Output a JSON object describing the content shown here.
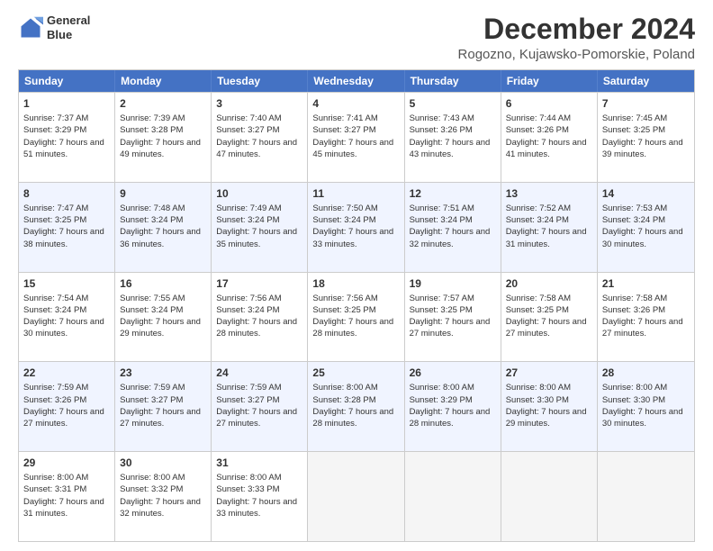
{
  "logo": {
    "line1": "General",
    "line2": "Blue"
  },
  "title": "December 2024",
  "subtitle": "Rogozno, Kujawsko-Pomorskie, Poland",
  "headers": [
    "Sunday",
    "Monday",
    "Tuesday",
    "Wednesday",
    "Thursday",
    "Friday",
    "Saturday"
  ],
  "weeks": [
    [
      {
        "day": "1",
        "rise": "Sunrise: 7:37 AM",
        "set": "Sunset: 3:29 PM",
        "daylight": "Daylight: 7 hours and 51 minutes."
      },
      {
        "day": "2",
        "rise": "Sunrise: 7:39 AM",
        "set": "Sunset: 3:28 PM",
        "daylight": "Daylight: 7 hours and 49 minutes."
      },
      {
        "day": "3",
        "rise": "Sunrise: 7:40 AM",
        "set": "Sunset: 3:27 PM",
        "daylight": "Daylight: 7 hours and 47 minutes."
      },
      {
        "day": "4",
        "rise": "Sunrise: 7:41 AM",
        "set": "Sunset: 3:27 PM",
        "daylight": "Daylight: 7 hours and 45 minutes."
      },
      {
        "day": "5",
        "rise": "Sunrise: 7:43 AM",
        "set": "Sunset: 3:26 PM",
        "daylight": "Daylight: 7 hours and 43 minutes."
      },
      {
        "day": "6",
        "rise": "Sunrise: 7:44 AM",
        "set": "Sunset: 3:26 PM",
        "daylight": "Daylight: 7 hours and 41 minutes."
      },
      {
        "day": "7",
        "rise": "Sunrise: 7:45 AM",
        "set": "Sunset: 3:25 PM",
        "daylight": "Daylight: 7 hours and 39 minutes."
      }
    ],
    [
      {
        "day": "8",
        "rise": "Sunrise: 7:47 AM",
        "set": "Sunset: 3:25 PM",
        "daylight": "Daylight: 7 hours and 38 minutes."
      },
      {
        "day": "9",
        "rise": "Sunrise: 7:48 AM",
        "set": "Sunset: 3:24 PM",
        "daylight": "Daylight: 7 hours and 36 minutes."
      },
      {
        "day": "10",
        "rise": "Sunrise: 7:49 AM",
        "set": "Sunset: 3:24 PM",
        "daylight": "Daylight: 7 hours and 35 minutes."
      },
      {
        "day": "11",
        "rise": "Sunrise: 7:50 AM",
        "set": "Sunset: 3:24 PM",
        "daylight": "Daylight: 7 hours and 33 minutes."
      },
      {
        "day": "12",
        "rise": "Sunrise: 7:51 AM",
        "set": "Sunset: 3:24 PM",
        "daylight": "Daylight: 7 hours and 32 minutes."
      },
      {
        "day": "13",
        "rise": "Sunrise: 7:52 AM",
        "set": "Sunset: 3:24 PM",
        "daylight": "Daylight: 7 hours and 31 minutes."
      },
      {
        "day": "14",
        "rise": "Sunrise: 7:53 AM",
        "set": "Sunset: 3:24 PM",
        "daylight": "Daylight: 7 hours and 30 minutes."
      }
    ],
    [
      {
        "day": "15",
        "rise": "Sunrise: 7:54 AM",
        "set": "Sunset: 3:24 PM",
        "daylight": "Daylight: 7 hours and 30 minutes."
      },
      {
        "day": "16",
        "rise": "Sunrise: 7:55 AM",
        "set": "Sunset: 3:24 PM",
        "daylight": "Daylight: 7 hours and 29 minutes."
      },
      {
        "day": "17",
        "rise": "Sunrise: 7:56 AM",
        "set": "Sunset: 3:24 PM",
        "daylight": "Daylight: 7 hours and 28 minutes."
      },
      {
        "day": "18",
        "rise": "Sunrise: 7:56 AM",
        "set": "Sunset: 3:25 PM",
        "daylight": "Daylight: 7 hours and 28 minutes."
      },
      {
        "day": "19",
        "rise": "Sunrise: 7:57 AM",
        "set": "Sunset: 3:25 PM",
        "daylight": "Daylight: 7 hours and 27 minutes."
      },
      {
        "day": "20",
        "rise": "Sunrise: 7:58 AM",
        "set": "Sunset: 3:25 PM",
        "daylight": "Daylight: 7 hours and 27 minutes."
      },
      {
        "day": "21",
        "rise": "Sunrise: 7:58 AM",
        "set": "Sunset: 3:26 PM",
        "daylight": "Daylight: 7 hours and 27 minutes."
      }
    ],
    [
      {
        "day": "22",
        "rise": "Sunrise: 7:59 AM",
        "set": "Sunset: 3:26 PM",
        "daylight": "Daylight: 7 hours and 27 minutes."
      },
      {
        "day": "23",
        "rise": "Sunrise: 7:59 AM",
        "set": "Sunset: 3:27 PM",
        "daylight": "Daylight: 7 hours and 27 minutes."
      },
      {
        "day": "24",
        "rise": "Sunrise: 7:59 AM",
        "set": "Sunset: 3:27 PM",
        "daylight": "Daylight: 7 hours and 27 minutes."
      },
      {
        "day": "25",
        "rise": "Sunrise: 8:00 AM",
        "set": "Sunset: 3:28 PM",
        "daylight": "Daylight: 7 hours and 28 minutes."
      },
      {
        "day": "26",
        "rise": "Sunrise: 8:00 AM",
        "set": "Sunset: 3:29 PM",
        "daylight": "Daylight: 7 hours and 28 minutes."
      },
      {
        "day": "27",
        "rise": "Sunrise: 8:00 AM",
        "set": "Sunset: 3:30 PM",
        "daylight": "Daylight: 7 hours and 29 minutes."
      },
      {
        "day": "28",
        "rise": "Sunrise: 8:00 AM",
        "set": "Sunset: 3:30 PM",
        "daylight": "Daylight: 7 hours and 30 minutes."
      }
    ],
    [
      {
        "day": "29",
        "rise": "Sunrise: 8:00 AM",
        "set": "Sunset: 3:31 PM",
        "daylight": "Daylight: 7 hours and 31 minutes."
      },
      {
        "day": "30",
        "rise": "Sunrise: 8:00 AM",
        "set": "Sunset: 3:32 PM",
        "daylight": "Daylight: 7 hours and 32 minutes."
      },
      {
        "day": "31",
        "rise": "Sunrise: 8:00 AM",
        "set": "Sunset: 3:33 PM",
        "daylight": "Daylight: 7 hours and 33 minutes."
      },
      {
        "day": "",
        "rise": "",
        "set": "",
        "daylight": ""
      },
      {
        "day": "",
        "rise": "",
        "set": "",
        "daylight": ""
      },
      {
        "day": "",
        "rise": "",
        "set": "",
        "daylight": ""
      },
      {
        "day": "",
        "rise": "",
        "set": "",
        "daylight": ""
      }
    ]
  ]
}
